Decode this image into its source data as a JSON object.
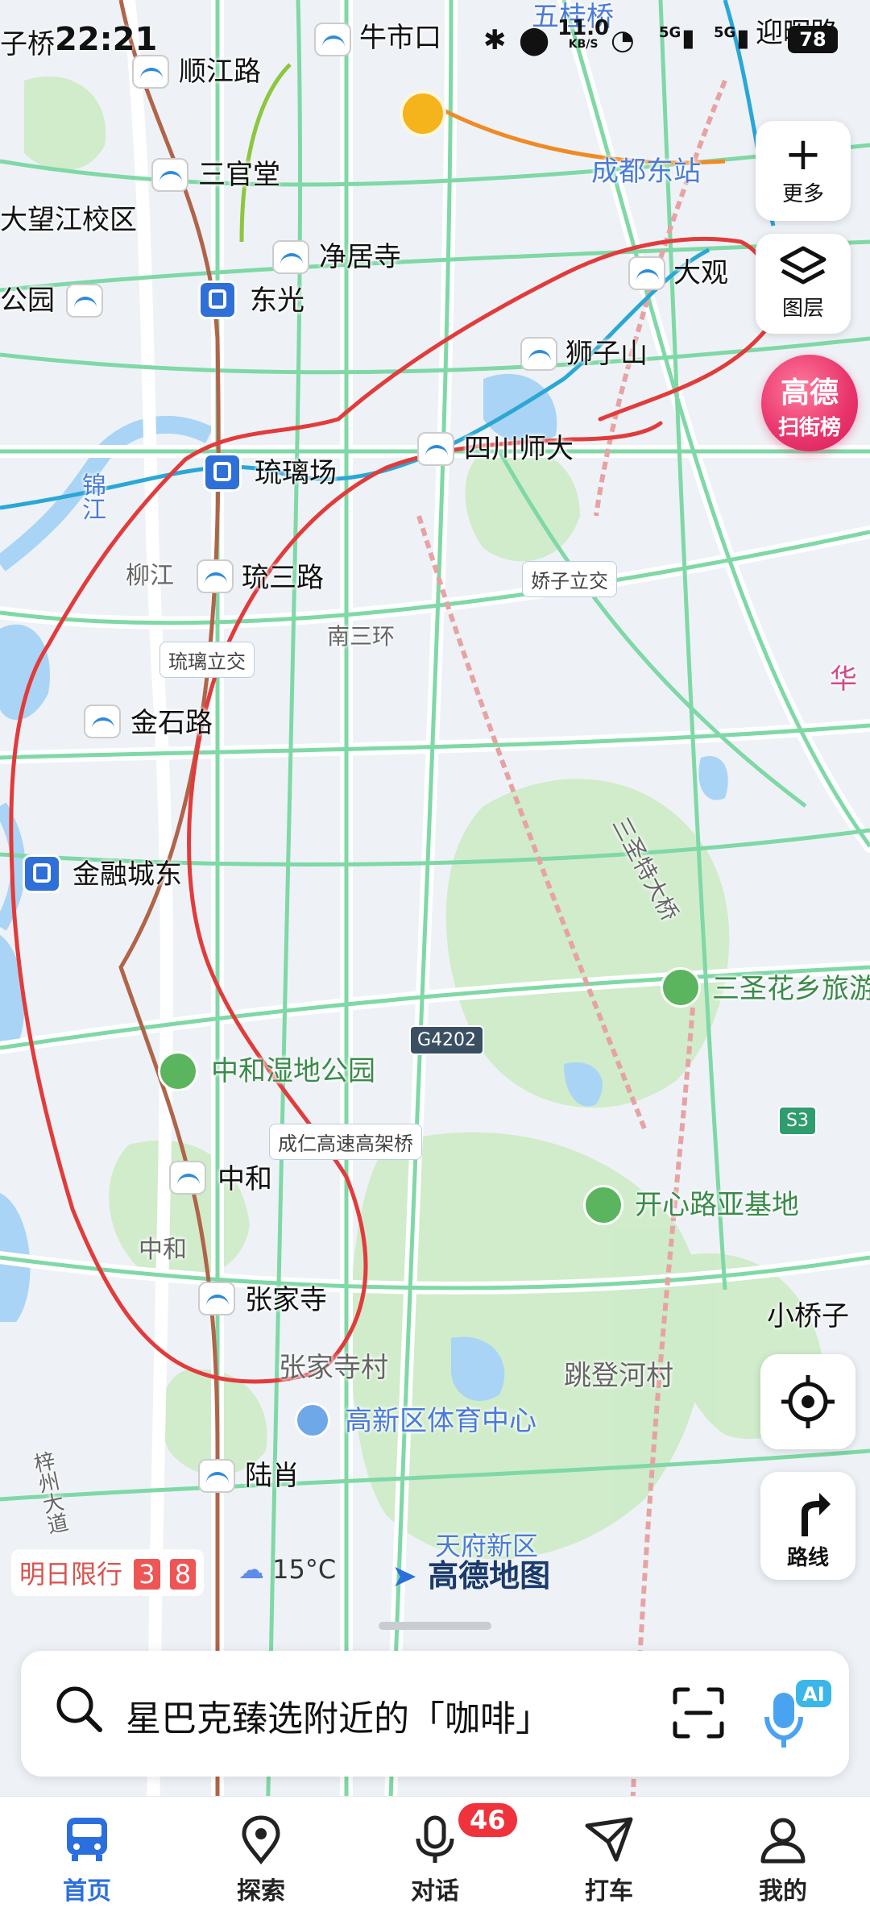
{
  "status_bar": {
    "time": "22:21",
    "speed_value": "11.0",
    "speed_unit": "KB/S",
    "net1": "5G",
    "net2": "5G",
    "battery": "78"
  },
  "map": {
    "labels": {
      "zi_qiao": "子桥",
      "shunjiang_rd": "顺江路",
      "niushikou": "牛市口",
      "wuguiqiao": "五桂桥",
      "yinghui_rd": "迎晖路",
      "sanguantang": "三官堂",
      "chengdu_east": "成都东站",
      "dawangjiang": "大望江校区",
      "jingjusi": "净居寺",
      "gongyuan": "公园",
      "dongguang": "东光",
      "daguan": "大观",
      "shizishan": "狮子山",
      "sichuan_normal": "四川师大",
      "liulichang": "琉璃场",
      "jinjiang": "锦江",
      "liujiang": "柳江",
      "liusan_rd": "琉三路",
      "jiaozi_interchange": "娇子立交",
      "south_ring3": "南三环",
      "liuli_interchange": "琉璃立交",
      "jinshi_rd": "金石路",
      "jinrongcheng_east": "金融城东",
      "sansheng_bridge": "三圣特大桥",
      "sansheng_flower": "三圣花乡旅游",
      "g4202": "G4202",
      "zhonghe_park": "中和湿地公园",
      "chengren_elevated": "成仁高速高架桥",
      "s3": "S3",
      "kaixin_rd": "开心路亚基地",
      "zhonghe_station": "中和",
      "zhonghe_area": "中和",
      "zhangjiasi": "张家寺",
      "xiaoqiaozi": "小桥子",
      "zhangjiasi_village": "张家寺村",
      "tiaodenghe": "跳登河村",
      "gaoxin_sports": "高新区体育中心",
      "luxiao": "陆肖",
      "tianfu_new": "天府新区",
      "huayang": "华",
      "road_vertical": "梓州大道"
    }
  },
  "right_tools": {
    "more_label": "更多",
    "layer_label": "图层",
    "gaode_line1": "高德",
    "gaode_line2": "扫街榜",
    "route_label": "路线"
  },
  "bottom_info": {
    "limit_label": "明日限行",
    "limit_num1": "3",
    "limit_num2": "8",
    "weather": "15°C",
    "logo": "高德地图"
  },
  "search": {
    "text": "星巴克臻选附近的「咖啡」"
  },
  "tabs": {
    "home": "首页",
    "explore": "探索",
    "chat": "对话",
    "taxi": "打车",
    "mine": "我的",
    "chat_badge": "46"
  },
  "colors": {
    "accent": "#2b6fde",
    "sketch_red": "#e23b3b",
    "badge_red": "#f0323c"
  }
}
